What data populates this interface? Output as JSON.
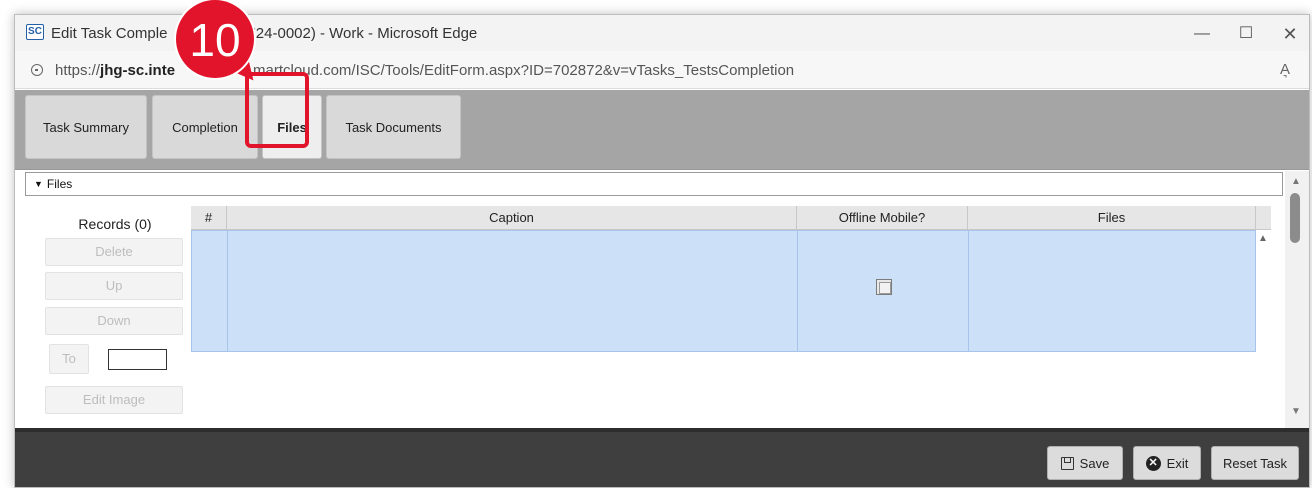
{
  "window": {
    "app_icon_text": "SC",
    "title": "Edit Task Comple",
    "title_tail": "724-0002) - Work - Microsoft Edge",
    "controls": {
      "minimize": "—",
      "maximize": "☐",
      "close": "✕"
    }
  },
  "address": {
    "url_prefix": "https://",
    "url_host_bold": "jhg-sc.inte",
    "url_host_rest": "martcloud.com",
    "url_path": "/ISC/Tools/EditForm.aspx?ID=702872&v=vTasks_TestsCompletion",
    "read_aloud_icon": "A͉"
  },
  "tabs": [
    {
      "label": "Task Summary"
    },
    {
      "label": "Completion"
    },
    {
      "label": "Files"
    },
    {
      "label": "Task Documents"
    }
  ],
  "section": {
    "title": "Files"
  },
  "records": {
    "label": "Records (0)",
    "delete": "Delete",
    "up": "Up",
    "down": "Down",
    "to": "To",
    "edit_image": "Edit Image"
  },
  "grid": {
    "columns": [
      "#",
      "Caption",
      "Offline Mobile?",
      "Files"
    ],
    "rows": [
      {
        "num": "",
        "caption": "",
        "offline_mobile": false,
        "files": ""
      }
    ]
  },
  "footer": {
    "save": "Save",
    "exit": "Exit",
    "reset_task": "Reset Task"
  },
  "annotation": {
    "step_number": "10",
    "color": "#e2142b"
  },
  "colors": {
    "tab_bar": "#a5a5a5",
    "selected_row": "#cce0f7",
    "footer": "#3f3f3f"
  }
}
